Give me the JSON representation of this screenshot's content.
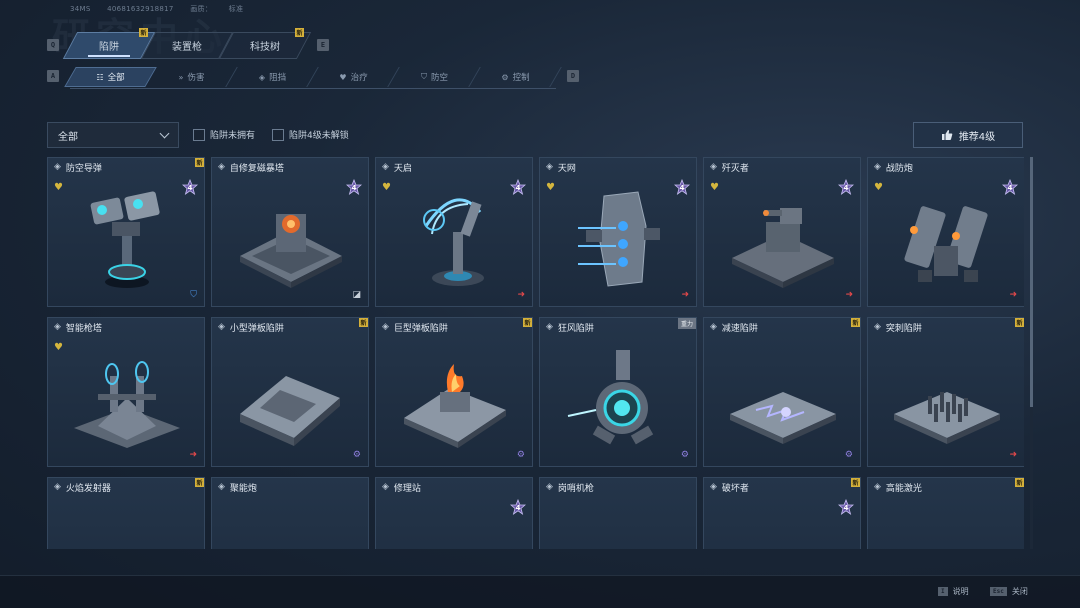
{
  "header": {
    "player_info": [
      "34MS",
      "40681632918817"
    ],
    "mode_label": "画质：",
    "mode_value": "标准",
    "background_title": "研究中心"
  },
  "keys": {
    "prev_tab": "Q",
    "next_tab": "E",
    "prev_sub": "A",
    "next_sub": "D"
  },
  "main_tabs": [
    {
      "label": "陷阱",
      "new": true,
      "active": true
    },
    {
      "label": "装置枪",
      "new": false,
      "active": false
    },
    {
      "label": "科技树",
      "new": true,
      "active": false
    }
  ],
  "new_badge": "新",
  "sub_tabs": [
    {
      "label": "全部",
      "icon": "grid-icon",
      "active": true
    },
    {
      "label": "伤害",
      "icon": "arrows-icon",
      "active": false
    },
    {
      "label": "阻挡",
      "icon": "shield-icon",
      "active": false
    },
    {
      "label": "治疗",
      "icon": "heart-icon",
      "active": false
    },
    {
      "label": "防空",
      "icon": "antiair-icon",
      "active": false
    },
    {
      "label": "控制",
      "icon": "gear-icon",
      "active": false
    }
  ],
  "filter": {
    "dropdown_value": "全部",
    "checkbox_1": "陷阱未拥有",
    "checkbox_2": "陷阱4级未解锁",
    "recommend_button": "推荐4级"
  },
  "cards": [
    {
      "name": "防空导弹",
      "new": true,
      "favorite": true,
      "level": "4",
      "type_icon": "antiair-icon",
      "art": "turret"
    },
    {
      "name": "自修复磁暴塔",
      "new": false,
      "favorite": false,
      "level": "4",
      "type_icon": "block-icon",
      "art": "platform-orange"
    },
    {
      "name": "天启",
      "new": false,
      "favorite": true,
      "level": "4",
      "type_icon": "damage-arrow-icon",
      "art": "tesla"
    },
    {
      "name": "天网",
      "new": false,
      "favorite": true,
      "level": "4",
      "type_icon": "damage-arrow-icon",
      "art": "pod"
    },
    {
      "name": "歼灭者",
      "new": false,
      "favorite": true,
      "level": "4",
      "type_icon": "damage-arrow-icon",
      "art": "platform-gun"
    },
    {
      "name": "战防炮",
      "new": false,
      "favorite": true,
      "level": "4",
      "type_icon": "damage-arrow-icon",
      "art": "twin-gun"
    },
    {
      "name": "智能枪塔",
      "new": false,
      "favorite": true,
      "level": "",
      "type_icon": "damage-arrow-icon",
      "art": "smart-turret"
    },
    {
      "name": "小型弹板陷阱",
      "new": true,
      "favorite": false,
      "level": "",
      "type_icon": "control-gear-icon",
      "art": "plate"
    },
    {
      "name": "巨型弹板陷阱",
      "new": true,
      "favorite": false,
      "level": "",
      "type_icon": "control-gear-icon",
      "art": "plate-fire"
    },
    {
      "name": "狂风陷阱",
      "new": false,
      "tag": "重力",
      "favorite": false,
      "level": "",
      "type_icon": "control-gear-icon",
      "art": "fan"
    },
    {
      "name": "减速陷阱",
      "new": true,
      "favorite": false,
      "level": "",
      "type_icon": "control-gear-icon",
      "art": "slow-plate"
    },
    {
      "name": "突刺陷阱",
      "new": true,
      "favorite": false,
      "level": "",
      "type_icon": "damage-arrow-icon",
      "art": "spike-plate"
    },
    {
      "name": "火焰发射器",
      "new": true,
      "favorite": false,
      "level": "",
      "type_icon": "",
      "art": "partial"
    },
    {
      "name": "聚能炮",
      "new": false,
      "favorite": false,
      "level": "",
      "type_icon": "",
      "art": "partial"
    },
    {
      "name": "修理站",
      "new": false,
      "favorite": false,
      "level": "4",
      "type_icon": "",
      "art": "partial"
    },
    {
      "name": "岗哨机枪",
      "new": false,
      "favorite": false,
      "level": "",
      "type_icon": "",
      "art": "partial"
    },
    {
      "name": "破坏者",
      "new": true,
      "favorite": false,
      "level": "4",
      "type_icon": "",
      "art": "partial"
    },
    {
      "name": "高能激光",
      "new": true,
      "favorite": false,
      "level": "",
      "type_icon": "",
      "art": "partial"
    }
  ],
  "footer": {
    "help_key": "I",
    "help_label": "说明",
    "close_key": "Esc",
    "close_label": "关闭"
  },
  "colors": {
    "accent_gold": "#d4b03a",
    "damage_red": "#e0484a",
    "control_purple": "#8f7fe0",
    "antiair_blue": "#4a90e0"
  }
}
